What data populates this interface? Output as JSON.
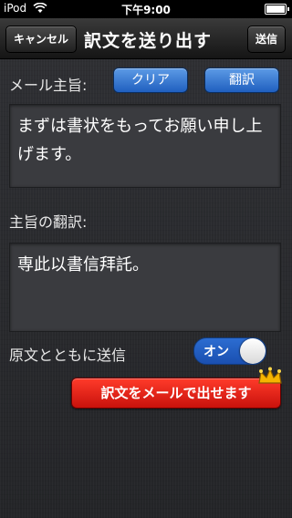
{
  "status": {
    "carrier": "iPod",
    "time": "下午9:00"
  },
  "navbar": {
    "cancel_label": "キャンセル",
    "title": "訳文を送り出す",
    "send_label": "送信"
  },
  "form": {
    "mail_subject_label": "メール主旨:",
    "clear_label": "クリア",
    "translate_label": "翻訳",
    "subject_text": "まずは書状をもってお願い申し上げます。",
    "translation_label": "主旨の翻訳:",
    "translation_text": "専此以書信拜託。",
    "send_original_label": "原文とともに送信",
    "toggle_state": "オン",
    "toggle_on": true,
    "send_by_mail_label": "訳文をメールで出せます"
  },
  "colors": {
    "accent_blue": "#2c6dd1",
    "action_red": "#e0221a",
    "crown_gold": "#f5b400"
  },
  "icons": {
    "wifi": "wifi-icon",
    "battery": "battery-icon",
    "crown": "crown-icon"
  }
}
